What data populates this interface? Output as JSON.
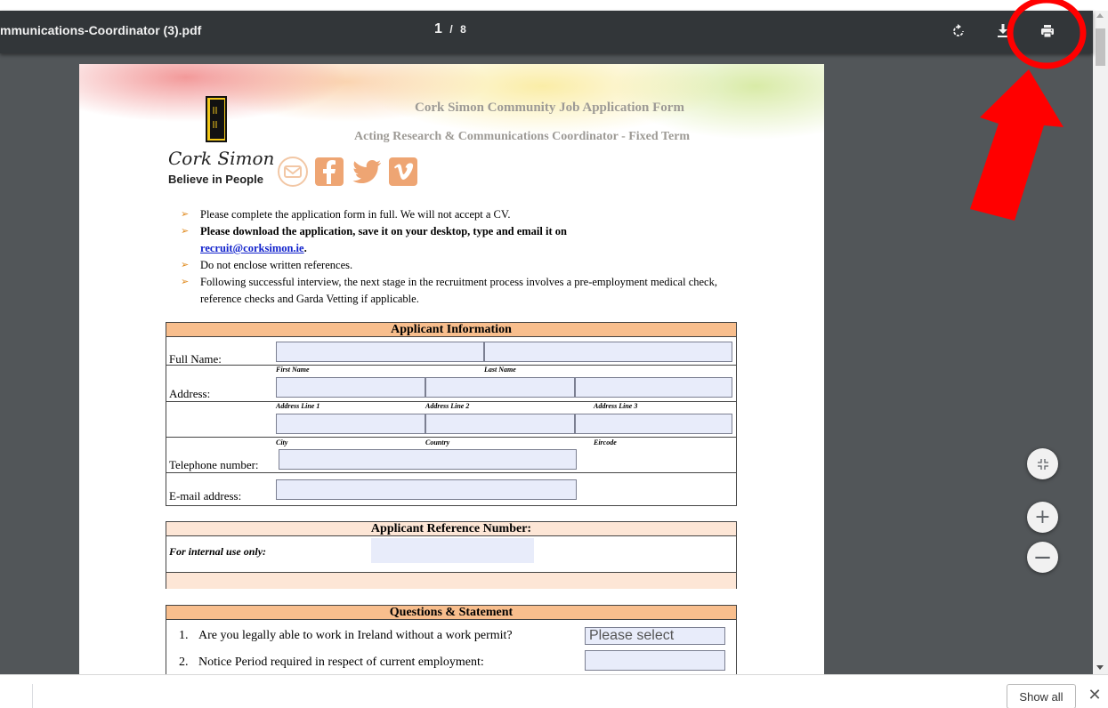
{
  "toolbar": {
    "title": "mmunications-Coordinator (3).pdf",
    "current_page": "1",
    "page_separator": "/",
    "total_pages": "8",
    "rotate_icon": "rotate-icon",
    "download_icon": "download-icon",
    "print_icon": "print-icon"
  },
  "page": {
    "logo_text": "Cork Simon",
    "logo_tagline": "Believe in People",
    "form_title": "Cork Simon Community Job Application Form",
    "form_subtitle": "Acting Research & Communications Coordinator - Fixed Term",
    "instructions": [
      {
        "text": "Please complete the application form in full. We will not accept a CV."
      },
      {
        "text": "Please download the application, save it on your desktop, type and email it on",
        "link": "recruit@corksimon.ie",
        "after": "."
      },
      {
        "text": "Do not enclose written references."
      },
      {
        "text": "Following successful interview, the next stage in the recruitment process involves a pre-employment medical check, reference checks and Garda Vetting if applicable."
      }
    ],
    "applicant": {
      "heading": "Applicant Information",
      "full_name_label": "Full Name:",
      "first_name": "First Name",
      "last_name": "Last Name",
      "address_label": "Address:",
      "address_line_1": "Address Line 1",
      "address_line_2": "Address Line 2",
      "address_line_3": "Address Line 3",
      "city": "City",
      "country": "Country",
      "eircode": "Eircode",
      "telephone_label": "Telephone number:",
      "email_label": "E-mail address:"
    },
    "reference": {
      "heading": "Applicant Reference Number:",
      "internal_label": "For internal use only:"
    },
    "questions": {
      "heading": "Questions & Statement",
      "items": [
        {
          "num": "1.",
          "text": "Are you legally able to work in Ireland without a work permit?",
          "select_value": "Please select"
        },
        {
          "num": "2.",
          "text": "Notice Period required in respect of current employment:"
        }
      ]
    }
  },
  "controls": {
    "fit_icon": "fit-to-page-icon",
    "zoom_in": "+",
    "zoom_out": "−"
  },
  "shelf": {
    "show_all": "Show all",
    "close": "✕"
  },
  "annotation_color": "#ff0000"
}
